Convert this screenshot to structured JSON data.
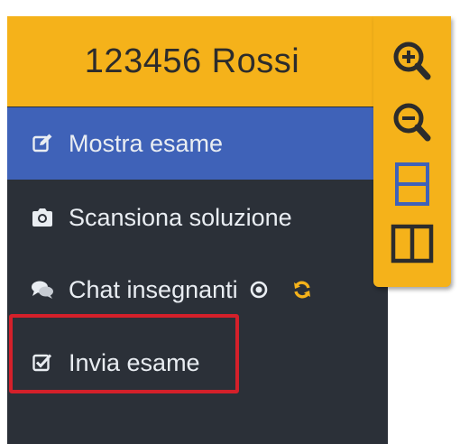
{
  "header": {
    "title": "123456 Rossi"
  },
  "menu": {
    "items": [
      {
        "label": "Mostra esame",
        "icon": "edit-icon",
        "active": true
      },
      {
        "label": "Scansiona soluzione",
        "icon": "camera-icon",
        "active": false
      },
      {
        "label": "Chat insegnanti",
        "icon": "chat-icon",
        "active": false
      },
      {
        "label": "Invia esame",
        "icon": "check-square-icon",
        "active": false
      }
    ]
  },
  "toolbar": {
    "buttons": [
      "zoom-in-icon",
      "zoom-out-icon",
      "split-horizontal-icon",
      "split-vertical-icon"
    ]
  },
  "colors": {
    "accent": "#f5b21a",
    "sidebar": "#2b3038",
    "active": "#3f62b8",
    "highlight": "#d4202a"
  }
}
